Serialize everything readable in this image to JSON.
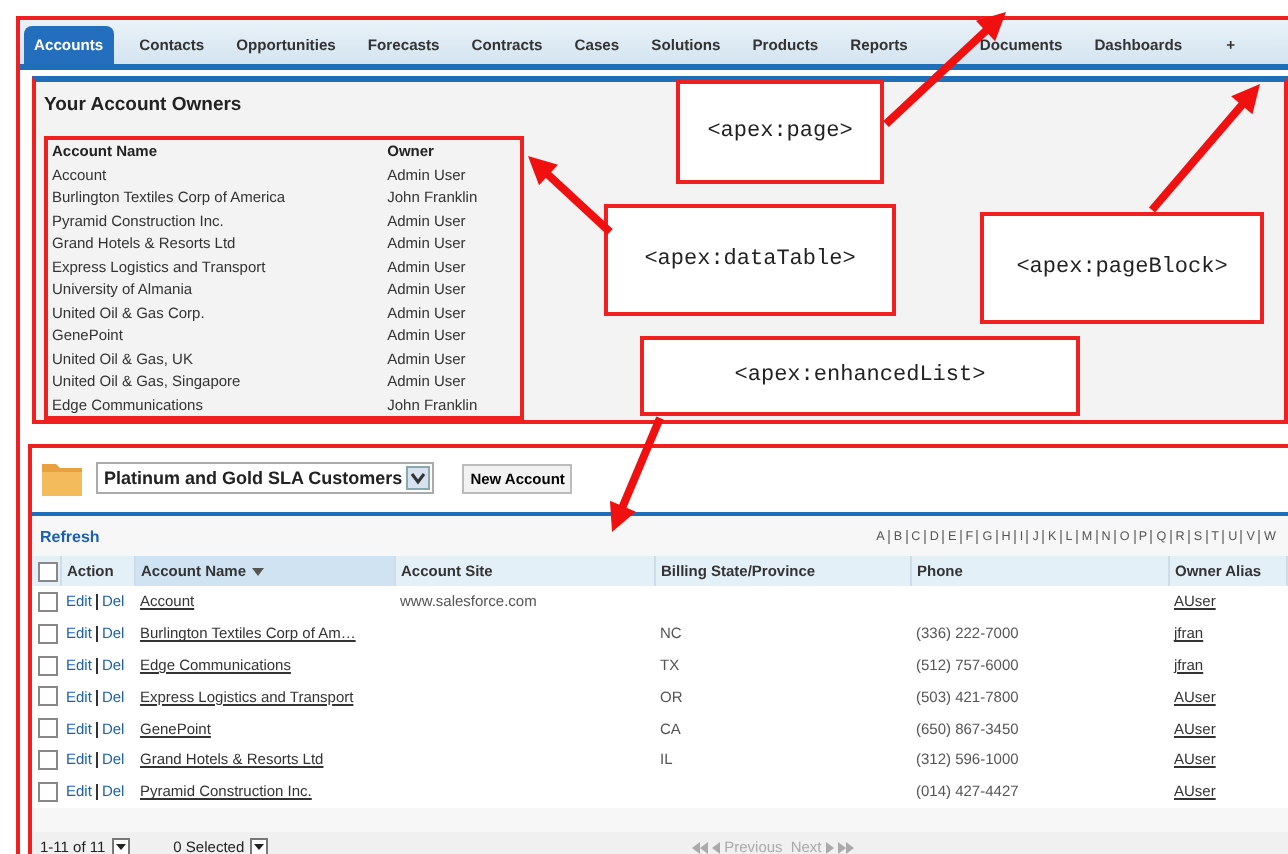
{
  "tabs": [
    {
      "label": "Accounts",
      "selected": true
    },
    {
      "label": "Contacts",
      "selected": false
    },
    {
      "label": "Opportunities",
      "selected": false
    },
    {
      "label": "Forecasts",
      "selected": false
    },
    {
      "label": "Contracts",
      "selected": false
    },
    {
      "label": "Cases",
      "selected": false
    },
    {
      "label": "Solutions",
      "selected": false
    },
    {
      "label": "Products",
      "selected": false
    },
    {
      "label": "Reports",
      "selected": false
    },
    {
      "label": "Documents",
      "selected": false
    },
    {
      "label": "Dashboards",
      "selected": false
    },
    {
      "label": "+",
      "selected": false
    }
  ],
  "page_block": {
    "title": "Your Account Owners",
    "columns": [
      "Account Name",
      "Owner"
    ],
    "rows": [
      [
        "Account",
        "Admin User"
      ],
      [
        "Burlington Textiles Corp of America",
        "John Franklin"
      ],
      [
        "Pyramid Construction Inc.",
        "Admin User"
      ],
      [
        "Grand Hotels & Resorts Ltd",
        "Admin User"
      ],
      [
        "Express Logistics and Transport",
        "Admin User"
      ],
      [
        "University of Almania",
        "Admin User"
      ],
      [
        "United Oil & Gas Corp.",
        "Admin User"
      ],
      [
        "GenePoint",
        "Admin User"
      ],
      [
        "United Oil & Gas, UK",
        "Admin User"
      ],
      [
        "United Oil & Gas, Singapore",
        "Admin User"
      ],
      [
        "Edge Communications",
        "John Franklin"
      ]
    ]
  },
  "callouts": [
    "<apex:page>",
    "<apex:dataTable>",
    "<apex:pageBlock>",
    "<apex:enhancedList>"
  ],
  "enhanced_list": {
    "view": "Platinum and Gold SLA Customers",
    "new_button": "New Account",
    "refresh": "Refresh",
    "letters": [
      "A",
      "B",
      "C",
      "D",
      "E",
      "F",
      "G",
      "H",
      "I",
      "J",
      "K",
      "L",
      "M",
      "N",
      "O",
      "P",
      "Q",
      "R",
      "S",
      "T",
      "U",
      "V",
      "W"
    ],
    "select_all_checked": false,
    "columns": [
      "Action",
      "Account Name",
      "Account Site",
      "Billing State/Province",
      "Phone",
      "Owner Alias"
    ],
    "rows": [
      {
        "checked": false,
        "edit": "Edit",
        "del": "Del",
        "name": "Account",
        "site": "www.salesforce.com",
        "state": "",
        "phone": "",
        "owner": "AUser"
      },
      {
        "checked": false,
        "edit": "Edit",
        "del": "Del",
        "name": "Burlington Textiles Corp of Am…",
        "site": "",
        "state": "NC",
        "phone": "(336) 222-7000",
        "owner": "jfran"
      },
      {
        "checked": false,
        "edit": "Edit",
        "del": "Del",
        "name": "Edge Communications",
        "site": "",
        "state": "TX",
        "phone": "(512) 757-6000",
        "owner": "jfran"
      },
      {
        "checked": false,
        "edit": "Edit",
        "del": "Del",
        "name": "Express Logistics and Transport",
        "site": "",
        "state": "OR",
        "phone": "(503) 421-7800",
        "owner": "AUser"
      },
      {
        "checked": false,
        "edit": "Edit",
        "del": "Del",
        "name": "GenePoint",
        "site": "",
        "state": "CA",
        "phone": "(650) 867-3450",
        "owner": "AUser"
      },
      {
        "checked": false,
        "edit": "Edit",
        "del": "Del",
        "name": "Grand Hotels & Resorts Ltd",
        "site": "",
        "state": "IL",
        "phone": "(312) 596-1000",
        "owner": "AUser"
      },
      {
        "checked": false,
        "edit": "Edit",
        "del": "Del",
        "name": "Pyramid Construction Inc.",
        "site": "",
        "state": "",
        "phone": "(014) 427-4427",
        "owner": "AUser"
      }
    ],
    "range": "1-11 of 11",
    "selected_count": "0 Selected",
    "previous": "Previous",
    "next": "Next",
    "previous_disabled": true,
    "next_disabled": true
  }
}
